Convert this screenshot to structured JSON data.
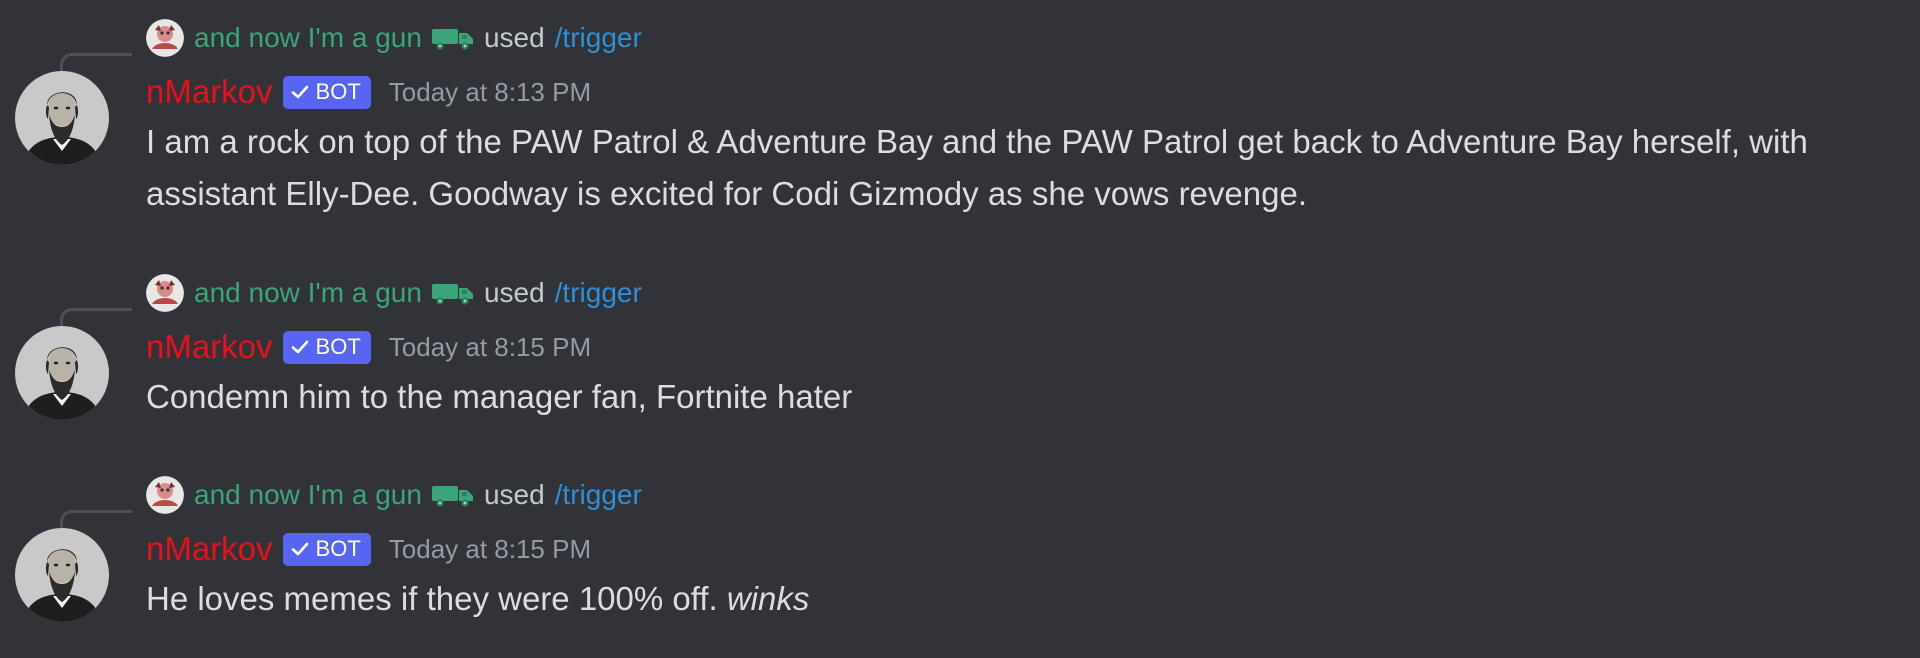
{
  "messages": [
    {
      "reply": {
        "user": "and now I'm a gun",
        "emoji": "truck-icon",
        "verb": "used",
        "command": "/trigger"
      },
      "author": "nMarkov",
      "badge": "BOT",
      "timestamp": "Today at 8:13 PM",
      "lines": [
        "I am a rock on top of the PAW Patrol & Adventure Bay and the PAW Patrol get back to Adventure Bay herself, with",
        "assistant Elly-Dee. Goodway is excited for Codi Gizmody as she vows revenge."
      ]
    },
    {
      "reply": {
        "user": "and now I'm a gun",
        "emoji": "truck-icon",
        "verb": "used",
        "command": "/trigger"
      },
      "author": "nMarkov",
      "badge": "BOT",
      "timestamp": "Today at 8:15 PM",
      "lines": [
        "Condemn him to the manager fan, Fortnite hater"
      ]
    },
    {
      "reply": {
        "user": "and now I'm a gun",
        "emoji": "truck-icon",
        "verb": "used",
        "command": "/trigger"
      },
      "author": "nMarkov",
      "badge": "BOT",
      "timestamp": "Today at 8:15 PM",
      "lines": [],
      "text_plain": "He loves memes if they were 100% off. ",
      "text_italic": "winks"
    }
  ],
  "colors": {
    "background": "#313338",
    "author": "#e8101b",
    "reply_user": "#3ba57a",
    "command_link": "#2f8fd6",
    "bot_badge": "#5865f2",
    "timestamp": "#949ba4",
    "message_text": "#dbdee1"
  }
}
